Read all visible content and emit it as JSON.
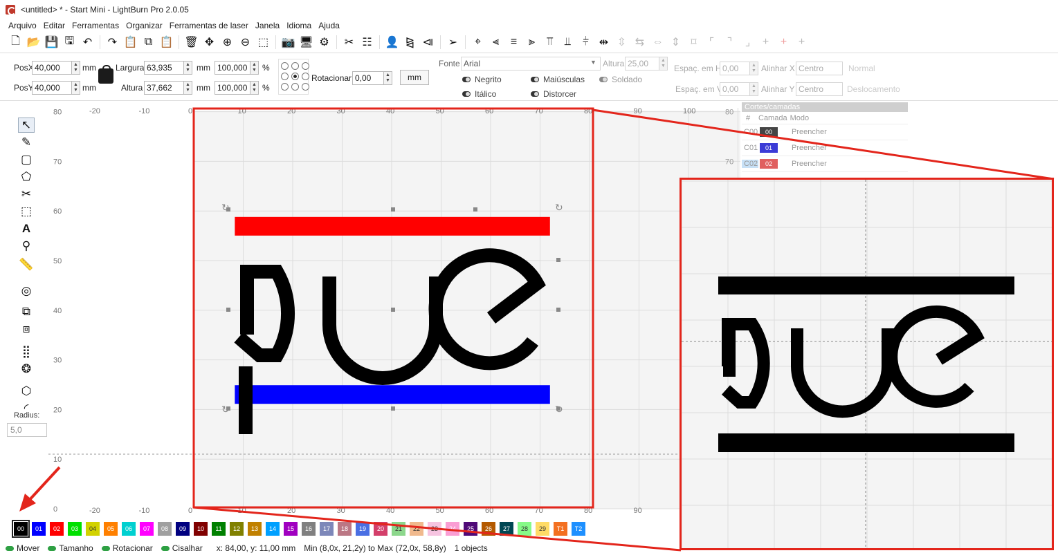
{
  "window": {
    "title": "<untitled> * - Start Mini - LightBurn Pro 2.0.05"
  },
  "menu": [
    "Arquivo",
    "Editar",
    "Ferramentas",
    "Organizar",
    "Ferramentas de laser",
    "Janela",
    "Idioma",
    "Ajuda"
  ],
  "toolbar": {
    "icons": [
      "new-file-icon",
      "open-folder-icon",
      "save-icon",
      "save-as-icon",
      "undo-icon",
      "redo-icon",
      "paste-special-icon",
      "copy-icon",
      "paste-icon",
      "delete-icon",
      "move-icon",
      "zoom-in-icon",
      "zoom-out-icon",
      "zoom-selection-icon",
      "camera-icon",
      "monitor-icon",
      "settings-icon",
      "tools-icon",
      "group-icon",
      "user-icon",
      "mirror-h-icon",
      "mirror-v-icon",
      "send-icon",
      "target-icon",
      "align-left-icon",
      "align-center-icon",
      "align-right-icon",
      "align-top-icon",
      "align-middle-icon",
      "align-bottom-icon",
      "distribute-h-icon",
      "distribute-v-icon",
      "move-together-icon",
      "space-h-icon",
      "space-v-icon",
      "nudge-icon",
      "corner-tl-icon",
      "corner-tr-icon",
      "corner-br-icon",
      "cross-icon",
      "cross-red-icon",
      "cross-faint-icon"
    ]
  },
  "props": {
    "posx_label": "PosX",
    "posx_value": "40,000",
    "posx_unit": "mm",
    "posy_label": "PosY",
    "posy_value": "40,000",
    "posy_unit": "mm",
    "width_label": "Largura",
    "width_value": "63,935",
    "width_unit": "mm",
    "height_label": "Altura",
    "height_value": "37,662",
    "height_unit": "mm",
    "scale_w_value": "100,000",
    "scale_h_value": "100,000",
    "percent": "%",
    "rotate_label": "Rotacionar",
    "rotate_value": "0,00",
    "units_button": "mm",
    "font_label": "Fonte",
    "font_value": "Arial",
    "font_height_label": "Altura",
    "font_height_value": "25,00",
    "bold_label": "Negrito",
    "italic_label": "Itálico",
    "caps_label": "Maiúsculas",
    "distort_label": "Distorcer",
    "welded_label": "Soldado",
    "hspace_label": "Espaç. em H",
    "hspace_value": "0,00",
    "vspace_label": "Espaç. em V",
    "vspace_value": "0,00",
    "alignx_label": "Alinhar X",
    "alignx_value": "Centro",
    "aligny_label": "Alinhar Y",
    "aligny_value": "Centro",
    "normal_label": "Normal",
    "offset_label": "Deslocamento"
  },
  "left_tools": {
    "icons": [
      "select-icon",
      "pen-icon",
      "rectangle-icon",
      "polygon-icon",
      "node-edit-icon",
      "frame-icon",
      "text-icon",
      "position-marker-icon",
      "measure-icon",
      "offset-icon",
      "boolean-union-icon",
      "boolean-subtract-icon",
      "array-grid-icon",
      "circular-array-icon",
      "edit-nodes-icon",
      "corner-radius-icon"
    ],
    "text_tool_label": "A",
    "radius_label": "Radius:",
    "radius_value": "5,0"
  },
  "canvas": {
    "top_ruler": [
      "-20",
      "-10",
      "0",
      "10",
      "20",
      "30",
      "40",
      "50",
      "60",
      "70",
      "80",
      "90",
      "100"
    ],
    "bottom_ruler": [
      "-20",
      "-10",
      "0",
      "10",
      "20",
      "30",
      "40",
      "50",
      "60",
      "70",
      "80",
      "90"
    ],
    "left_ruler": [
      "80",
      "70",
      "60",
      "50",
      "40",
      "30",
      "20",
      "10",
      "0"
    ],
    "right_ruler": [
      "80",
      "70"
    ],
    "logo_text": "Due",
    "colors": {
      "top_bar": "#ff0000",
      "bottom_bar": "#0000ff",
      "logo": "#000000"
    }
  },
  "layers": {
    "title": "Cortes/camadas",
    "headers": {
      "num": "#",
      "layer": "Camada",
      "mode": "Modo"
    },
    "rows": [
      {
        "name": "C00",
        "swatch": "00",
        "mode": "Preencher",
        "color": "#444444"
      },
      {
        "name": "C01",
        "swatch": "01",
        "mode": "Preencher",
        "color": "#3b3bd6"
      },
      {
        "name": "C02",
        "swatch": "02",
        "mode": "Preencher",
        "color": "#e06060",
        "selected": true
      }
    ]
  },
  "palette": [
    {
      "label": "00",
      "color": "#000000",
      "selected": true
    },
    {
      "label": "01",
      "color": "#0000ff"
    },
    {
      "label": "02",
      "color": "#ff0000"
    },
    {
      "label": "03",
      "color": "#00e000"
    },
    {
      "label": "04",
      "color": "#d2d200"
    },
    {
      "label": "05",
      "color": "#ff8000"
    },
    {
      "label": "06",
      "color": "#00d0d0"
    },
    {
      "label": "07",
      "color": "#ff00ff"
    },
    {
      "label": "08",
      "color": "#a0a0a0"
    },
    {
      "label": "09",
      "color": "#000080"
    },
    {
      "label": "10",
      "color": "#800000"
    },
    {
      "label": "11",
      "color": "#008000"
    },
    {
      "label": "12",
      "color": "#808000"
    },
    {
      "label": "13",
      "color": "#c08000"
    },
    {
      "label": "14",
      "color": "#00a0ff"
    },
    {
      "label": "15",
      "color": "#a000c0"
    },
    {
      "label": "16",
      "color": "#808080"
    },
    {
      "label": "17",
      "color": "#7d87b9"
    },
    {
      "label": "18",
      "color": "#bb7784"
    },
    {
      "label": "19",
      "color": "#4a6fe3"
    },
    {
      "label": "20",
      "color": "#d33f6a"
    },
    {
      "label": "21",
      "color": "#8cd78c"
    },
    {
      "label": "22",
      "color": "#f0b98d"
    },
    {
      "label": "23",
      "color": "#f6c4e1"
    },
    {
      "label": "24",
      "color": "#fa9ed4"
    },
    {
      "label": "25",
      "color": "#500a78"
    },
    {
      "label": "26",
      "color": "#b45a00"
    },
    {
      "label": "27",
      "color": "#004754"
    },
    {
      "label": "28",
      "color": "#86fa88"
    },
    {
      "label": "29",
      "color": "#ffdb66"
    },
    {
      "label": "T1",
      "color": "#f37021"
    },
    {
      "label": "T2",
      "color": "#1e90ff"
    }
  ],
  "status": {
    "move": "Mover",
    "size": "Tamanho",
    "rotate": "Rotacionar",
    "shear": "Cisalhar",
    "coords": "x: 84,00, y: 11,00 mm",
    "bounds": "Min (8,0x, 21,2y) to Max (72,0x, 58,8y)",
    "count": "1 objects"
  },
  "annotation_colors": {
    "callout": "#e3251b"
  }
}
